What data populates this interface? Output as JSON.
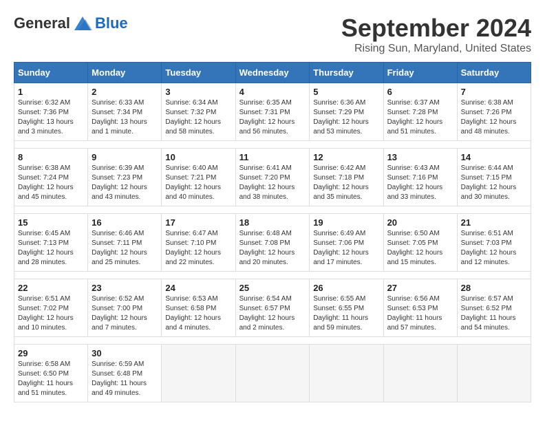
{
  "header": {
    "logo_general": "General",
    "logo_blue": "Blue",
    "month": "September 2024",
    "location": "Rising Sun, Maryland, United States"
  },
  "weekdays": [
    "Sunday",
    "Monday",
    "Tuesday",
    "Wednesday",
    "Thursday",
    "Friday",
    "Saturday"
  ],
  "weeks": [
    [
      {
        "num": "1",
        "rise": "6:32 AM",
        "set": "7:36 PM",
        "daylight": "13 hours and 3 minutes."
      },
      {
        "num": "2",
        "rise": "6:33 AM",
        "set": "7:34 PM",
        "daylight": "13 hours and 1 minute."
      },
      {
        "num": "3",
        "rise": "6:34 AM",
        "set": "7:32 PM",
        "daylight": "12 hours and 58 minutes."
      },
      {
        "num": "4",
        "rise": "6:35 AM",
        "set": "7:31 PM",
        "daylight": "12 hours and 56 minutes."
      },
      {
        "num": "5",
        "rise": "6:36 AM",
        "set": "7:29 PM",
        "daylight": "12 hours and 53 minutes."
      },
      {
        "num": "6",
        "rise": "6:37 AM",
        "set": "7:28 PM",
        "daylight": "12 hours and 51 minutes."
      },
      {
        "num": "7",
        "rise": "6:38 AM",
        "set": "7:26 PM",
        "daylight": "12 hours and 48 minutes."
      }
    ],
    [
      {
        "num": "8",
        "rise": "6:38 AM",
        "set": "7:24 PM",
        "daylight": "12 hours and 45 minutes."
      },
      {
        "num": "9",
        "rise": "6:39 AM",
        "set": "7:23 PM",
        "daylight": "12 hours and 43 minutes."
      },
      {
        "num": "10",
        "rise": "6:40 AM",
        "set": "7:21 PM",
        "daylight": "12 hours and 40 minutes."
      },
      {
        "num": "11",
        "rise": "6:41 AM",
        "set": "7:20 PM",
        "daylight": "12 hours and 38 minutes."
      },
      {
        "num": "12",
        "rise": "6:42 AM",
        "set": "7:18 PM",
        "daylight": "12 hours and 35 minutes."
      },
      {
        "num": "13",
        "rise": "6:43 AM",
        "set": "7:16 PM",
        "daylight": "12 hours and 33 minutes."
      },
      {
        "num": "14",
        "rise": "6:44 AM",
        "set": "7:15 PM",
        "daylight": "12 hours and 30 minutes."
      }
    ],
    [
      {
        "num": "15",
        "rise": "6:45 AM",
        "set": "7:13 PM",
        "daylight": "12 hours and 28 minutes."
      },
      {
        "num": "16",
        "rise": "6:46 AM",
        "set": "7:11 PM",
        "daylight": "12 hours and 25 minutes."
      },
      {
        "num": "17",
        "rise": "6:47 AM",
        "set": "7:10 PM",
        "daylight": "12 hours and 22 minutes."
      },
      {
        "num": "18",
        "rise": "6:48 AM",
        "set": "7:08 PM",
        "daylight": "12 hours and 20 minutes."
      },
      {
        "num": "19",
        "rise": "6:49 AM",
        "set": "7:06 PM",
        "daylight": "12 hours and 17 minutes."
      },
      {
        "num": "20",
        "rise": "6:50 AM",
        "set": "7:05 PM",
        "daylight": "12 hours and 15 minutes."
      },
      {
        "num": "21",
        "rise": "6:51 AM",
        "set": "7:03 PM",
        "daylight": "12 hours and 12 minutes."
      }
    ],
    [
      {
        "num": "22",
        "rise": "6:51 AM",
        "set": "7:02 PM",
        "daylight": "12 hours and 10 minutes."
      },
      {
        "num": "23",
        "rise": "6:52 AM",
        "set": "7:00 PM",
        "daylight": "12 hours and 7 minutes."
      },
      {
        "num": "24",
        "rise": "6:53 AM",
        "set": "6:58 PM",
        "daylight": "12 hours and 4 minutes."
      },
      {
        "num": "25",
        "rise": "6:54 AM",
        "set": "6:57 PM",
        "daylight": "12 hours and 2 minutes."
      },
      {
        "num": "26",
        "rise": "6:55 AM",
        "set": "6:55 PM",
        "daylight": "11 hours and 59 minutes."
      },
      {
        "num": "27",
        "rise": "6:56 AM",
        "set": "6:53 PM",
        "daylight": "11 hours and 57 minutes."
      },
      {
        "num": "28",
        "rise": "6:57 AM",
        "set": "6:52 PM",
        "daylight": "11 hours and 54 minutes."
      }
    ],
    [
      {
        "num": "29",
        "rise": "6:58 AM",
        "set": "6:50 PM",
        "daylight": "11 hours and 51 minutes."
      },
      {
        "num": "30",
        "rise": "6:59 AM",
        "set": "6:48 PM",
        "daylight": "11 hours and 49 minutes."
      },
      null,
      null,
      null,
      null,
      null
    ]
  ]
}
